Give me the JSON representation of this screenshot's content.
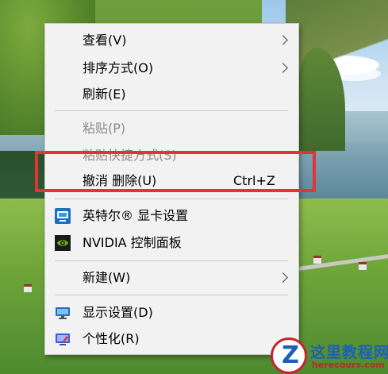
{
  "context_menu": {
    "items": [
      {
        "label": "查看(V)",
        "submenu": true,
        "enabled": true
      },
      {
        "label": "排序方式(O)",
        "submenu": true,
        "enabled": true
      },
      {
        "label": "刷新(E)",
        "enabled": true
      },
      {
        "label": "粘贴(P)",
        "enabled": false
      },
      {
        "label": "粘贴快捷方式(S)",
        "enabled": false
      },
      {
        "label": "撤消 删除(U)",
        "shortcut": "Ctrl+Z",
        "enabled": true
      },
      {
        "label": "英特尔® 显卡设置",
        "icon": "intel-graphics-icon",
        "enabled": true
      },
      {
        "label": "NVIDIA 控制面板",
        "icon": "nvidia-icon",
        "enabled": true
      },
      {
        "label": "新建(W)",
        "submenu": true,
        "enabled": true
      },
      {
        "label": "显示设置(D)",
        "icon": "display-settings-icon",
        "enabled": true
      },
      {
        "label": "个性化(R)",
        "icon": "personalize-icon",
        "enabled": true
      }
    ]
  },
  "watermark": {
    "logo_letter": "Z",
    "title": "这里教程网",
    "url": "herecours.com"
  },
  "colors": {
    "highlight": "#e3323a",
    "menu_background": "#f2f2f2",
    "disabled_text": "#8c8c8c",
    "watermark_blue": "#1c5fb8",
    "watermark_red": "#c8232c"
  }
}
